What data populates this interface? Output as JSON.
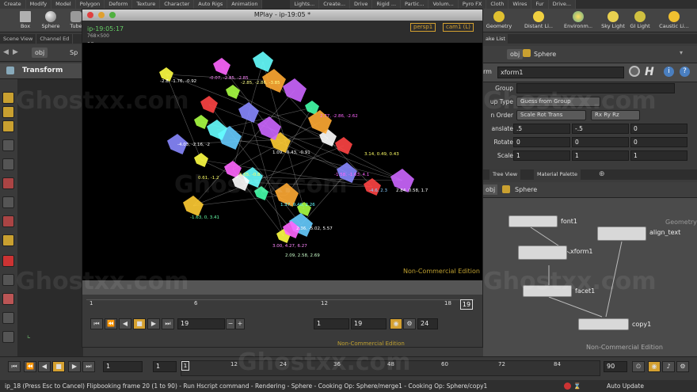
{
  "shelf_tabs": [
    "Create",
    "Modify",
    "Model",
    "Polygon",
    "Deform",
    "Texture",
    "Character",
    "Auto Rigs",
    "Animation",
    "Lights...",
    "Create...",
    "Drive",
    "Rigid ...",
    "Partic...",
    "Volum...",
    "Pyro FX",
    "Cloth",
    "Wires",
    "Fur",
    "Drive..."
  ],
  "shelf_tools_left": [
    {
      "label": "Box",
      "icon": "box-icon"
    },
    {
      "label": "Sphere",
      "icon": "sphere-icon"
    },
    {
      "label": "Tube",
      "icon": "tube-icon"
    }
  ],
  "shelf_tools_right": [
    {
      "label": "Geometry",
      "icon": "light-icon"
    },
    {
      "label": "Distant Li...",
      "icon": "distant-light-icon"
    },
    {
      "label": "Environm...",
      "icon": "env-light-icon"
    },
    {
      "label": "Sky Light",
      "icon": "sky-light-icon"
    },
    {
      "label": "GI Light",
      "icon": "gi-light-icon"
    },
    {
      "label": "Caustic Li...",
      "icon": "caustic-light-icon"
    }
  ],
  "left_tabs": [
    "Scene View",
    "Channel Ed"
  ],
  "left_path": {
    "obj": "obj",
    "node": "Sp"
  },
  "left_title": "Transform",
  "mplay": {
    "title": "MPlay - ip-19:05 *",
    "image_name": "ip-19:05:17",
    "resolution": "768×500",
    "frame_label": "19",
    "camera_menu": "persp1",
    "cam_menu": "cam1 (L)",
    "overlay": "Non-Commercial Edition",
    "ticks": [
      "1",
      "6",
      "12",
      "18"
    ],
    "current_frame": "19",
    "frame_field": "19",
    "range_start": "1",
    "range_end": "19",
    "fps": "24"
  },
  "viewport_labels": [
    {
      "text": "-2.8, -1.76, -0.92",
      "c": "#ffffff"
    },
    {
      "text": "-0.07, -2.85, -2.85",
      "c": "#ff88ff"
    },
    {
      "text": "-2.85, -2.86, -3.85",
      "c": "#ffff88"
    },
    {
      "text": "2.77, -2.86, -2.62",
      "c": "#ff66ff"
    },
    {
      "text": "-4.03, -2.16, -2",
      "c": "#ffffff"
    },
    {
      "text": "3.14, 0.49, 0.43",
      "c": "#ffff66"
    },
    {
      "text": "1.09, -0.43, -0.91",
      "c": "#ffffff"
    },
    {
      "text": "-1.58, -1.63, 4.1",
      "c": "#ff66ff"
    },
    {
      "text": "-4.6, 2.3",
      "c": "#88ccff"
    },
    {
      "text": "2.84, 0.58, 1.7",
      "c": "#ffffff"
    },
    {
      "text": "0.61, -1.2",
      "c": "#ffff66"
    },
    {
      "text": "1.37, 0.46, 2.26",
      "c": "#66ffff"
    },
    {
      "text": "-5.65, -0.8",
      "c": "#ffff66"
    },
    {
      "text": "-1.63, 0, 3.41",
      "c": "#66ffaa"
    },
    {
      "text": "2.36, -5.02, 5.57",
      "c": "#ffffff"
    },
    {
      "text": "3.00, 4.27, 6.27",
      "c": "#ff88ff"
    },
    {
      "text": "2.09, 2.58, 2.69",
      "c": "#ccffcc"
    }
  ],
  "right": {
    "top_tab": "ake List",
    "path_obj": "obj",
    "path_node": "Sphere",
    "node_name": "xform1",
    "params": [
      {
        "label": "Group",
        "value": "",
        "kind": "field"
      },
      {
        "label": "up Type",
        "value": "Guess from Group",
        "kind": "menu"
      },
      {
        "label": "n Order",
        "value": "Scale Rot Trans",
        "value2": "Rx Ry Rz",
        "kind": "menu2"
      },
      {
        "label": "anslate",
        "values": [
          ".5",
          "-.5",
          "0"
        ],
        "kind": "vec"
      },
      {
        "label": "Rotate",
        "values": [
          "0",
          "0",
          "0"
        ],
        "kind": "vec"
      },
      {
        "label": "Scale",
        "values": [
          "1",
          "1",
          "1"
        ],
        "kind": "vec"
      }
    ],
    "net_tabs": [
      "Tree View",
      "Material Palette"
    ],
    "net_path_obj": "obj",
    "net_path_node": "Sphere",
    "nodes": [
      {
        "name": "font1"
      },
      {
        "name": "align_text"
      },
      {
        "name": "xform1"
      },
      {
        "name": "facet1"
      },
      {
        "name": "copy1"
      }
    ],
    "net_overlay": "Non-Commercial Edition",
    "net_badge": "Geometry"
  },
  "playbar": {
    "frame": "1",
    "start": "1",
    "ticks": [
      "12",
      "24",
      "36",
      "48",
      "60",
      "72",
      "84"
    ],
    "marker": "1",
    "end": "90"
  },
  "status": "ip_18 (Press Esc to Cancel) Flipbooking frame 20 (1 to 90) - Run Hscript command - Rendering - Sphere - Cooking Op:  Sphere/merge1 - Cooking Op:  Sphere/copy1",
  "auto_update": "Auto Update",
  "watermark": "Ghostxx.com"
}
